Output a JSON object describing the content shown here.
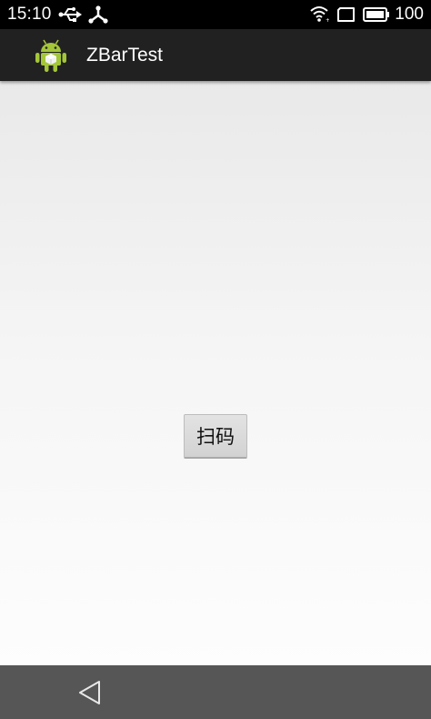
{
  "status_bar": {
    "time": "15:10",
    "battery_level": "100",
    "icons": [
      "usb-icon",
      "share-icon",
      "wifi-icon",
      "window-icon",
      "battery-icon"
    ]
  },
  "action_bar": {
    "title": "ZBarTest",
    "app_icon": "android-icon"
  },
  "main": {
    "scan_button_label": "扫码"
  },
  "nav_bar": {
    "back_icon": "back-icon"
  },
  "colors": {
    "status_bar_bg": "#000000",
    "action_bar_bg": "#212121",
    "nav_bar_bg": "#565656",
    "android_green": "#a4c639"
  }
}
